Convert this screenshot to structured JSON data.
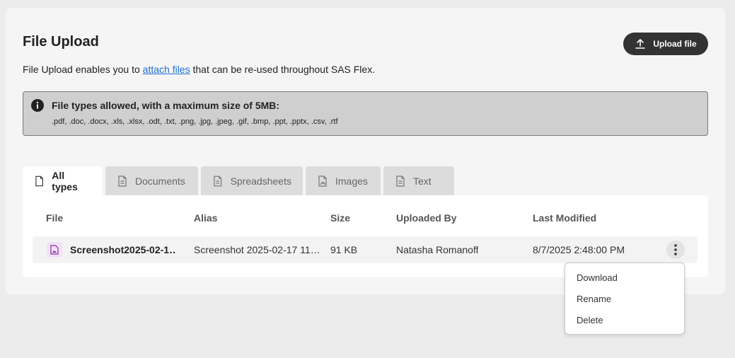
{
  "header": {
    "title": "File Upload",
    "intro_before": "File Upload enables you to ",
    "intro_link": "attach files",
    "intro_after": " that can be re-used throughout SAS Flex.",
    "upload_label": "Upload file"
  },
  "info": {
    "title": "File types allowed, with a maximum size of 5MB:",
    "types": ".pdf, .doc, .docx, .xls, .xlsx, .odt, .txt, .png, .jpg, .jpeg, .gif, .bmp, .ppt, .pptx, .csv, .rtf"
  },
  "tabs": [
    {
      "label": "All types",
      "active": true
    },
    {
      "label": "Documents",
      "active": false
    },
    {
      "label": "Spreadsheets",
      "active": false
    },
    {
      "label": "Images",
      "active": false
    },
    {
      "label": "Text",
      "active": false
    }
  ],
  "table": {
    "columns": [
      "File",
      "Alias",
      "Size",
      "Uploaded By",
      "Last Modified"
    ],
    "rows": [
      {
        "file": "Screenshot2025-02-1…",
        "alias": "Screenshot 2025-02-17 11…",
        "size": "91 KB",
        "uploaded_by": "Natasha Romanoff",
        "last_modified": "8/7/2025 2:48:00 PM"
      }
    ]
  },
  "context_menu": {
    "items": [
      "Download",
      "Rename",
      "Delete"
    ]
  },
  "colors": {
    "link": "#1f6fd1",
    "button_bg": "#333333",
    "info_bg": "#cfcfcf",
    "file_icon": "#8a2aa8"
  },
  "icons": {
    "upload": "upload-icon",
    "info": "info-icon",
    "tab": "file-icon",
    "row_file": "image-file-icon",
    "menu": "kebab-icon"
  }
}
